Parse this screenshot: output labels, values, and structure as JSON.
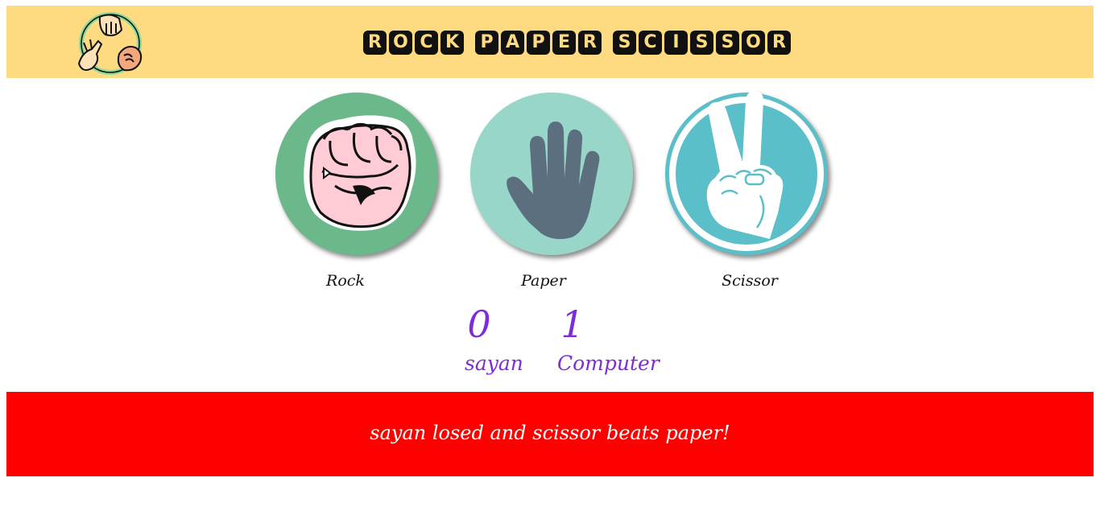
{
  "header": {
    "title_words": [
      [
        "R",
        "O",
        "C",
        "K"
      ],
      [
        "P",
        "A",
        "P",
        "E",
        "R"
      ],
      [
        "S",
        "C",
        "I",
        "S",
        "S",
        "O",
        "R"
      ]
    ],
    "logo_icon": "rock-paper-scissors-hands-icon",
    "background": "#fedb81"
  },
  "choices": [
    {
      "id": "rock",
      "label": "Rock",
      "icon": "fist-icon",
      "circle_color": "#6bb98a"
    },
    {
      "id": "paper",
      "label": "Paper",
      "icon": "open-hand-icon",
      "circle_color": "#98d6c9"
    },
    {
      "id": "scissor",
      "label": "Scissor",
      "icon": "victory-hand-icon",
      "circle_color": "#5abfc8"
    }
  ],
  "scoreboard": {
    "user_score": "0",
    "user_name": "sayan",
    "computer_score": "1",
    "computer_name": "Computer",
    "color": "#7e2bd9"
  },
  "result": {
    "message": "sayan losed and scissor beats paper!",
    "background": "#ff0000"
  }
}
